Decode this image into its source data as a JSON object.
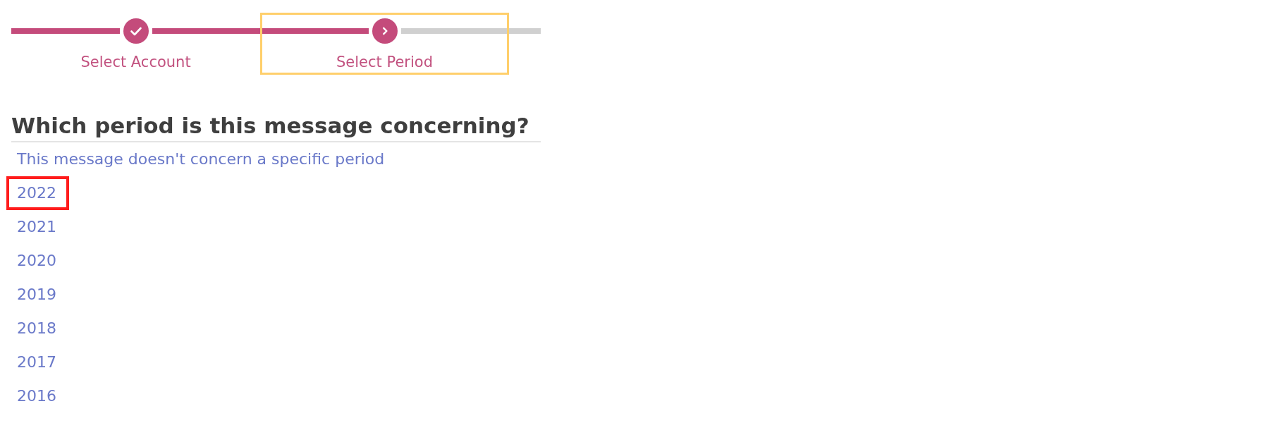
{
  "stepper": {
    "steps": [
      {
        "label": "Select Account",
        "kind": "completed",
        "focused": false
      },
      {
        "label": "Select Period",
        "kind": "current",
        "focused": true
      }
    ]
  },
  "question": {
    "heading": "Which period is this message concerning?",
    "options": [
      {
        "label": "This message doesn't concern a specific period",
        "focused": false
      },
      {
        "label": "2022",
        "focused": true
      },
      {
        "label": "2021",
        "focused": false
      },
      {
        "label": "2020",
        "focused": false
      },
      {
        "label": "2019",
        "focused": false
      },
      {
        "label": "2018",
        "focused": false
      },
      {
        "label": "2017",
        "focused": false
      },
      {
        "label": "2016",
        "focused": false
      }
    ]
  }
}
